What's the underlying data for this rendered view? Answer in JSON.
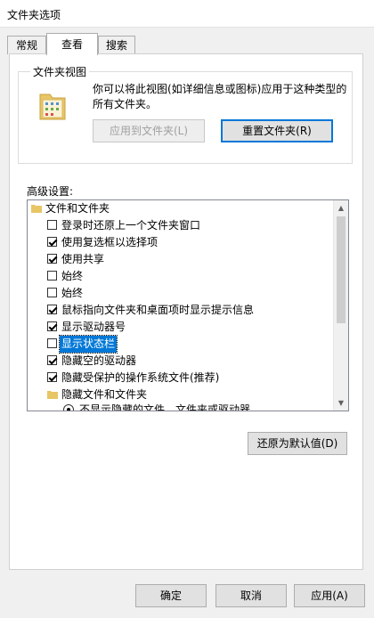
{
  "window": {
    "title": "文件夹选项"
  },
  "tabs": [
    {
      "label": "常规"
    },
    {
      "label": "查看"
    },
    {
      "label": "搜索"
    }
  ],
  "folder_views": {
    "legend": "文件夹视图",
    "description": "你可以将此视图(如详细信息或图标)应用于这种类型的所有文件夹。",
    "apply_button": "应用到文件夹(L)",
    "reset_button": "重置文件夹(R)"
  },
  "advanced": {
    "label": "高级设置:",
    "items": [
      {
        "type": "folder",
        "label": "文件和文件夹"
      },
      {
        "type": "checkbox",
        "checked": false,
        "label": "登录时还原上一个文件夹窗口"
      },
      {
        "type": "checkbox",
        "checked": true,
        "label": "使用复选框以选择项"
      },
      {
        "type": "checkbox",
        "checked": true,
        "label": "使用共享"
      },
      {
        "type": "checkbox",
        "checked": false,
        "label": "始终"
      },
      {
        "type": "checkbox",
        "checked": false,
        "label": "始终"
      },
      {
        "type": "checkbox",
        "checked": true,
        "label": "鼠标指向文件夹和桌面项时显示提示信息"
      },
      {
        "type": "checkbox",
        "checked": true,
        "label": "显示驱动器号"
      },
      {
        "type": "checkbox",
        "checked": false,
        "label": "显示状态栏",
        "selected": true
      },
      {
        "type": "checkbox",
        "checked": true,
        "label": "隐藏空的驱动器"
      },
      {
        "type": "checkbox",
        "checked": true,
        "label": "隐藏受保护的操作系统文件(推荐)"
      },
      {
        "type": "folder",
        "label": "隐藏文件和文件夹"
      },
      {
        "type": "radio",
        "checked": true,
        "label": "不显示隐藏的文件、文件夹或驱动器"
      }
    ],
    "restore_defaults_button": "还原为默认值(D)"
  },
  "dialog_buttons": {
    "ok": "确定",
    "cancel": "取消",
    "apply": "应用(A)"
  },
  "colors": {
    "selection": "#0078d7",
    "focus_border": "#0078d7"
  }
}
